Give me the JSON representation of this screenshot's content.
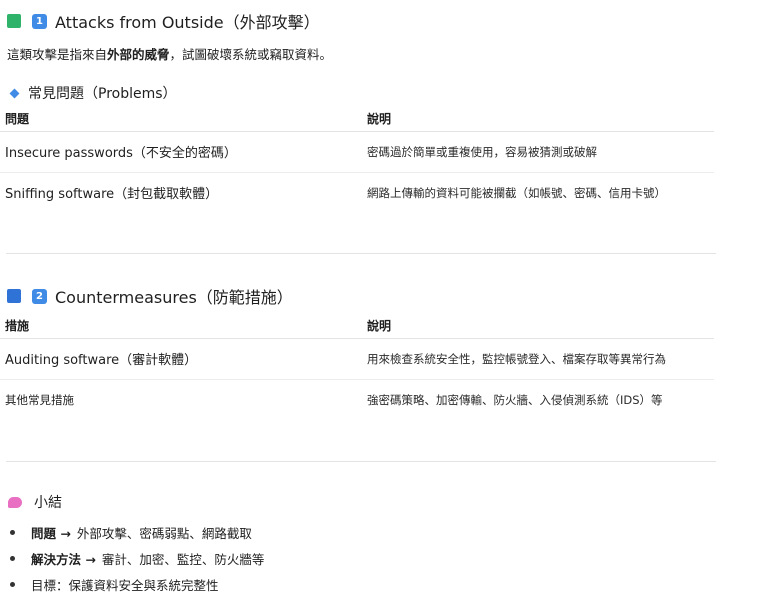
{
  "section1": {
    "num": "1",
    "title": "Attacks from Outside（外部攻擊）",
    "intro_prefix": "這類攻擊是指來自",
    "intro_bold": "外部的威脅",
    "intro_suffix": "，試圖破壞系統或竊取資料。",
    "subtitle": "常見問題（Problems）",
    "columns": [
      "問題",
      "說明"
    ],
    "rows": [
      [
        "Insecure passwords（不安全的密碼）",
        "密碼過於簡單或重複使用，容易被猜測或破解"
      ],
      [
        "Sniffing software（封包截取軟體）",
        "網路上傳輸的資料可能被攔截（如帳號、密碼、信用卡號）"
      ]
    ]
  },
  "section2": {
    "num": "2",
    "title": "Countermeasures（防範措施）",
    "columns": [
      "措施",
      "說明"
    ],
    "rows": [
      [
        "Auditing software（審計軟體）",
        "用來檢查系統安全性，監控帳號登入、檔案存取等異常行為"
      ],
      [
        "其他常見措施",
        "強密碼策略、加密傳輸、防火牆、入侵偵測系統（IDS）等"
      ]
    ]
  },
  "summary": {
    "title": "小結",
    "items": [
      {
        "bold": "問題 →",
        "text": "外部攻擊、密碼弱點、網路截取"
      },
      {
        "bold": "解決方法 →",
        "text": "審計、加密、監控、防火牆等"
      },
      {
        "bold": "",
        "text": "目標：保護資料安全與系統完整性"
      }
    ]
  },
  "colors": {
    "green_square": "#2fb36b",
    "blue_square": "#2f73d6",
    "badge": "#3f8be6",
    "summary_icon": "#e86fc2"
  }
}
